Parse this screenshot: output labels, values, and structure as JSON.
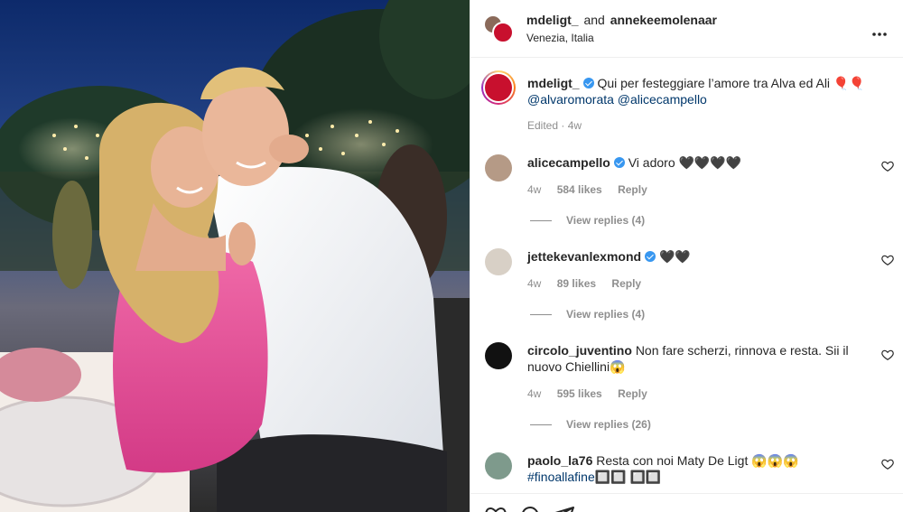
{
  "header": {
    "user1": "mdeligt_",
    "and_text": "and",
    "user2": "anneke",
    "user2_rest": "emolenaar",
    "location": "Venezia, Italia",
    "more_icon": "more-horizontal-icon"
  },
  "caption": {
    "username": "mdeligt_",
    "text": "Qui per festeggiare l’amore tra Alva ed Ali 🎈🎈",
    "mentions": "@alvaromorata @alicecampello",
    "edited": "Edited · 4w"
  },
  "comments": [
    {
      "username": "alicecampello",
      "verified": true,
      "text": "Vi adoro 🖤🖤🖤🖤",
      "time": "4w",
      "likes": "584 likes",
      "reply": "Reply",
      "view_replies": "View replies (4)"
    },
    {
      "username": "jettekevanlexmond",
      "verified": true,
      "text": "🖤🖤",
      "time": "4w",
      "likes": "89 likes",
      "reply": "Reply",
      "view_replies": "View replies (4)"
    },
    {
      "username": "circolo_juventino",
      "verified": false,
      "text": "Non fare scherzi, rinnova e resta. Sii il nuovo Chiellini😱",
      "time": "4w",
      "likes": "595 likes",
      "reply": "Reply",
      "view_replies": "View replies (26)"
    },
    {
      "username": "paolo_la76",
      "verified": false,
      "text": "Resta con noi Maty De Ligt 😱😱😱",
      "hashtag": "#finoallafine",
      "tail": "🔲🔲 🔲🔲"
    }
  ],
  "icons": {
    "like": "heart-icon",
    "comment": "comment-icon",
    "share": "share-icon"
  }
}
